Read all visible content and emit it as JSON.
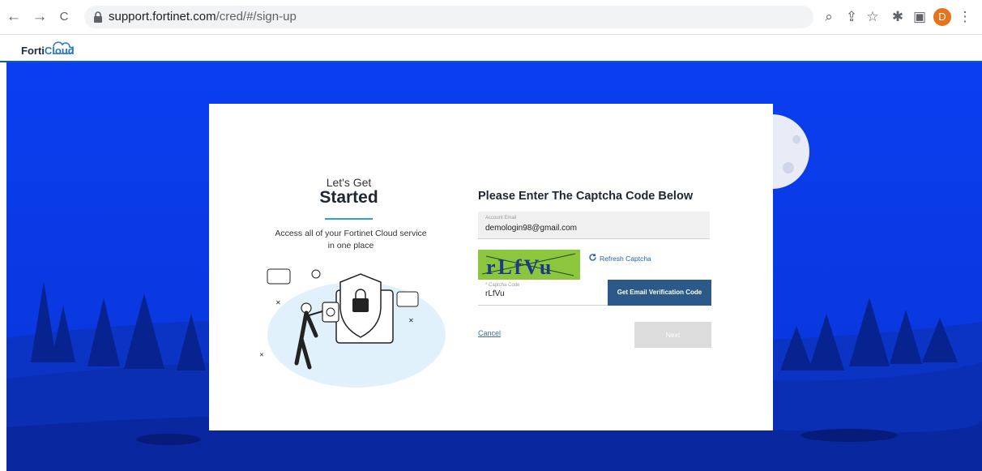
{
  "browser": {
    "url_domain": "support.fortinet.com",
    "url_path": "/cred/#/sign-up",
    "nav_back": "←",
    "nav_forward": "→",
    "nav_reload": "C",
    "avatar_letter": "D",
    "toolbar_icons": [
      "zoom-icon",
      "share-icon",
      "bookmark-star-icon",
      "extensions-icon",
      "side-panel-icon",
      "menu-dots-icon"
    ]
  },
  "header": {
    "logo_text_a": "Forti",
    "logo_text_b": "Cloud"
  },
  "card": {
    "left": {
      "lets_get": "Let's Get",
      "started": "Started",
      "access_text": "Access all of your Fortinet Cloud service in one place"
    },
    "right": {
      "heading": "Please Enter The Captcha Code Below",
      "email_label": "Account Email",
      "email_value": "demologin98@gmail.com",
      "captcha_image_text": "rLfVu",
      "refresh_label": "Refresh Captcha",
      "captcha_label": "* Captcha Code",
      "captcha_value": "rLfVu",
      "get_code_label": "Get Email Verification Code",
      "cancel_label": "Cancel",
      "next_label": "Next"
    }
  },
  "colors": {
    "sky": "#0a3ef0",
    "accent": "#29a2df",
    "primary_button": "#2b5a8a",
    "disabled_button": "#dcdcdc"
  }
}
